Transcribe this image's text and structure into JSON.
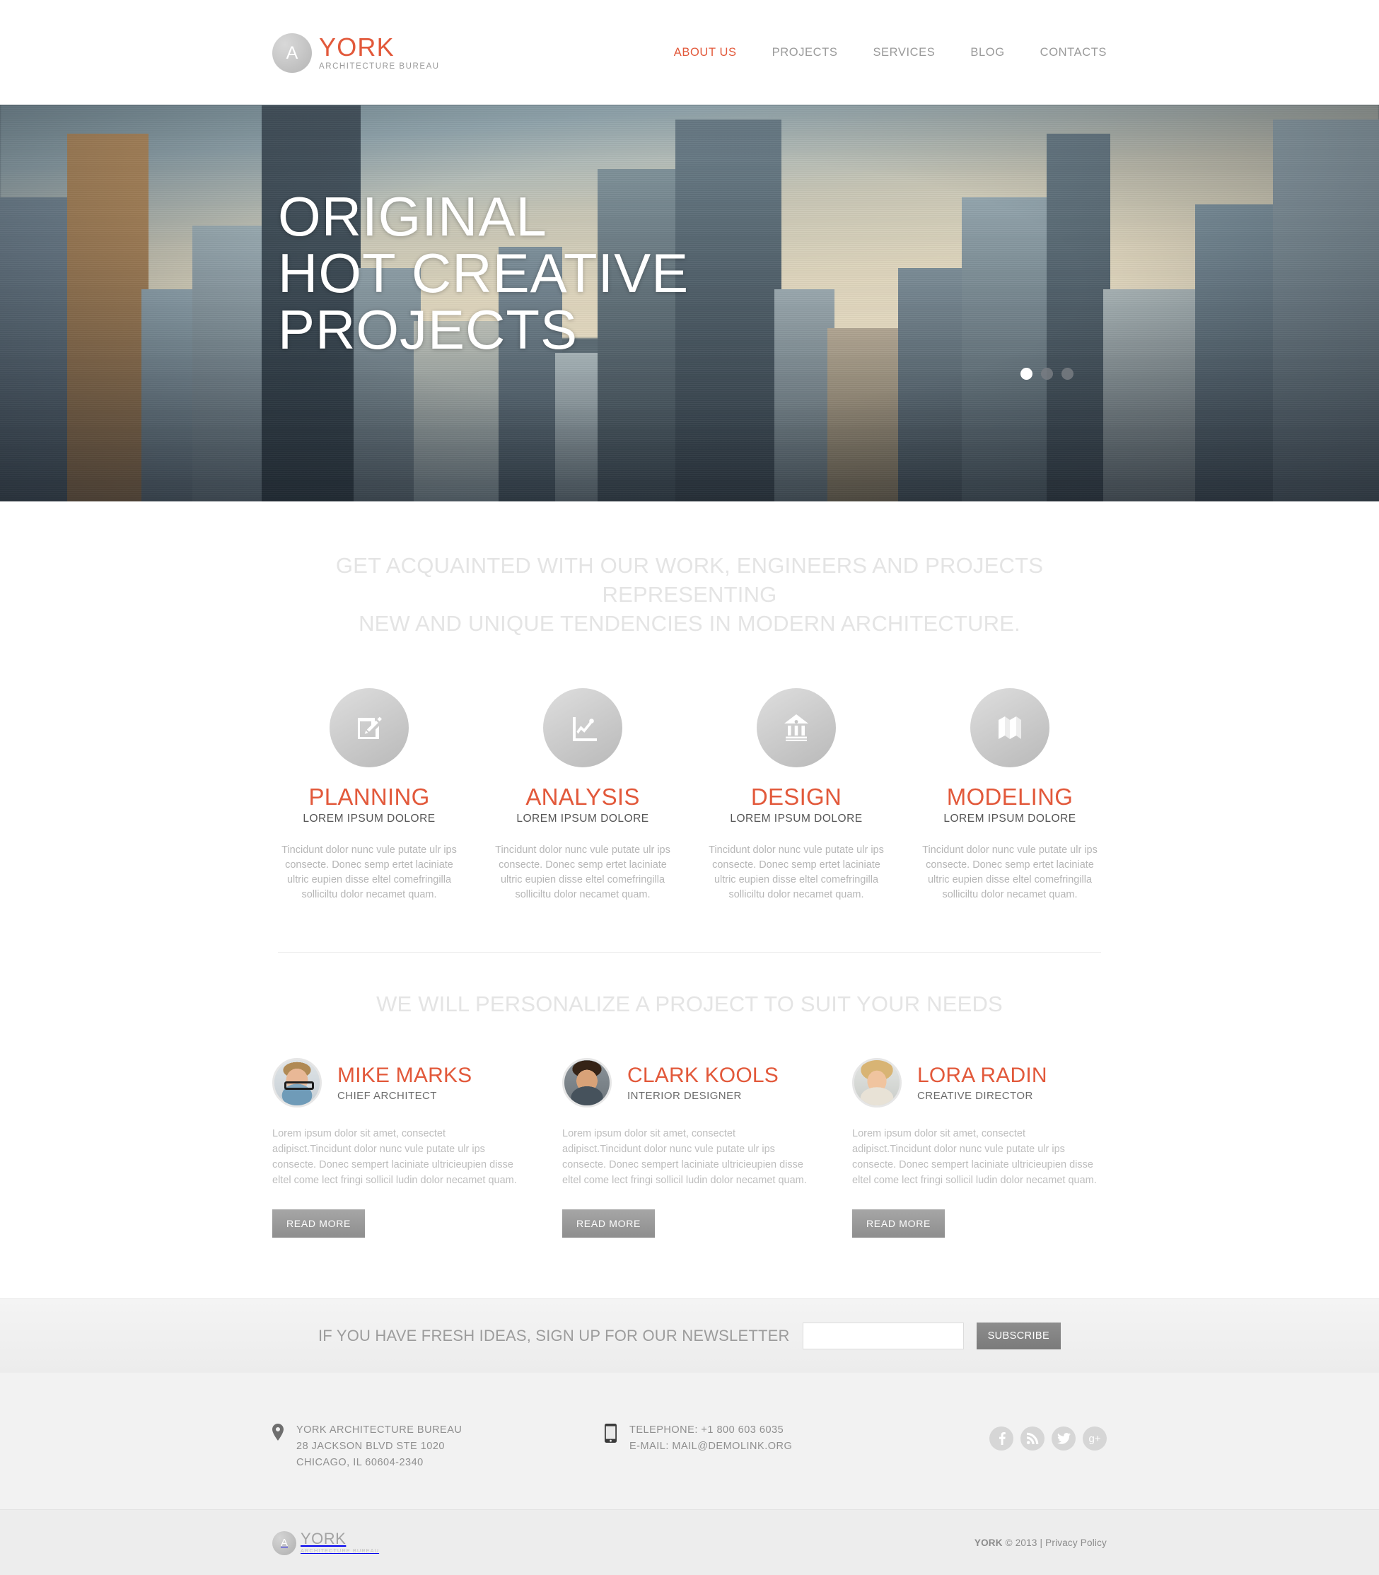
{
  "brand": {
    "accent": "#e2593b",
    "badge_letter": "A",
    "name": "YORK",
    "tagline": "ARCHITECTURE BUREAU"
  },
  "nav": {
    "items": [
      {
        "label": "ABOUT US",
        "active": true
      },
      {
        "label": "PROJECTS",
        "active": false
      },
      {
        "label": "SERVICES",
        "active": false
      },
      {
        "label": "BLOG",
        "active": false
      },
      {
        "label": "CONTACTS",
        "active": false
      }
    ]
  },
  "hero": {
    "title": "ORIGINAL\nHOT CREATIVE\nPROJECTS",
    "slides": 3,
    "active_slide": 1
  },
  "intro": {
    "heading": "GET ACQUAINTED WITH OUR WORK, ENGINEERS AND PROJECTS REPRESENTING\nNEW AND UNIQUE TENDENCIES IN MODERN ARCHITECTURE."
  },
  "services": [
    {
      "icon": "pencil-square-icon",
      "title": "PLANNING",
      "subtitle": "LOREM IPSUM DOLORE",
      "text": "Tincidunt dolor nunc vule putate ulr ips consecte. Donec semp ertet laciniate ultric eupien disse eltel comefringilla solliciltu dolor necamet quam."
    },
    {
      "icon": "line-chart-icon",
      "title": "ANALYSIS",
      "subtitle": "LOREM IPSUM DOLORE",
      "text": "Tincidunt dolor nunc vule putate ulr ips consecte. Donec semp ertet laciniate ultric eupien disse eltel comefringilla solliciltu dolor necamet quam."
    },
    {
      "icon": "bank-building-icon",
      "title": "DESIGN",
      "subtitle": "LOREM IPSUM DOLORE",
      "text": "Tincidunt dolor nunc vule putate ulr ips consecte. Donec semp ertet laciniate ultric eupien disse eltel comefringilla solliciltu dolor necamet quam."
    },
    {
      "icon": "folded-map-icon",
      "title": "MODELING",
      "subtitle": "LOREM IPSUM DOLORE",
      "text": "Tincidunt dolor nunc vule putate ulr ips consecte. Donec semp ertet laciniate ultric eupien disse eltel comefringilla solliciltu dolor necamet quam."
    }
  ],
  "team_heading": "WE WILL PERSONALIZE A PROJECT TO SUIT YOUR NEEDS",
  "team": [
    {
      "name": "MIKE MARKS",
      "role": "CHIEF ARCHITECT",
      "text": "Lorem ipsum dolor sit amet, consectet adipisct.Tincidunt dolor nunc vule putate ulr ips consecte. Donec sempert laciniate ultricieupien disse eltel come lect fringi sollicil ludin dolor necamet quam.",
      "button": "READ MORE",
      "avatar": "man-with-glasses-photo"
    },
    {
      "name": "CLARK KOOLS",
      "role": "INTERIOR DESIGNER",
      "text": "Lorem ipsum dolor sit amet, consectet adipisct.Tincidunt dolor nunc vule putate ulr ips consecte. Donec sempert laciniate ultricieupien disse eltel come lect fringi sollicil ludin dolor necamet quam.",
      "button": "READ MORE",
      "avatar": "dark-haired-man-photo"
    },
    {
      "name": "LORA RADIN",
      "role": "CREATIVE DIRECTOR",
      "text": "Lorem ipsum dolor sit amet, consectet adipisct.Tincidunt dolor nunc vule putate ulr ips consecte. Donec sempert laciniate ultricieupien disse eltel come lect fringi sollicil ludin dolor necamet quam.",
      "button": "READ MORE",
      "avatar": "blonde-woman-photo"
    }
  ],
  "newsletter": {
    "label": "IF YOU HAVE FRESH IDEAS, SIGN UP FOR OUR NEWSLETTER",
    "input_value": "",
    "input_placeholder": "",
    "button": "SUBSCRIBE"
  },
  "footer": {
    "address": {
      "icon": "map-pin-icon",
      "line1": "YORK ARCHITECTURE BUREAU",
      "line2": "28 JACKSON BLVD STE 1020",
      "line3": "CHICAGO, IL 60604-2340"
    },
    "contact": {
      "icon": "mobile-phone-icon",
      "line1": "TELEPHONE: +1 800 603 6035",
      "line2": "E-MAIL: MAIL@DEMOLINK.ORG"
    },
    "social": [
      {
        "icon": "facebook-icon",
        "label": "f"
      },
      {
        "icon": "rss-icon",
        "label": ""
      },
      {
        "icon": "twitter-icon",
        "label": ""
      },
      {
        "icon": "google-plus-icon",
        "label": "g+"
      }
    ],
    "bottom": {
      "badge_letter": "A",
      "name": "YORK",
      "tagline": "ARCHITECTURE BUREAU",
      "copyright_brand": "YORK",
      "copyright_text": " © 2013 | ",
      "privacy": "Privacy Policy"
    }
  }
}
